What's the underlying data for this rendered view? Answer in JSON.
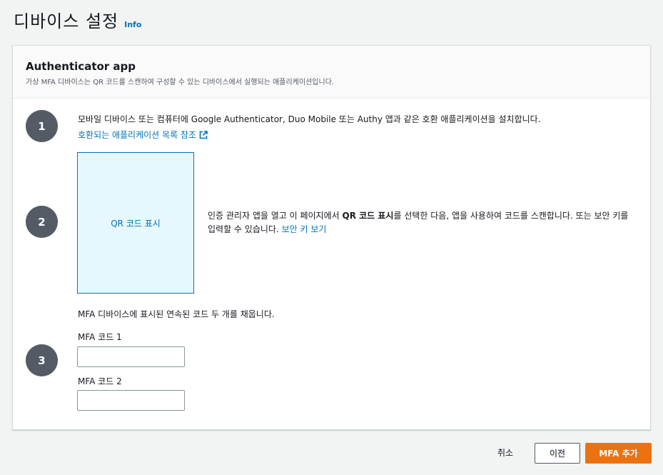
{
  "header": {
    "title": "디바이스 설정",
    "info_label": "Info"
  },
  "panel": {
    "title": "Authenticator app",
    "description": "가상 MFA 디바이스는 QR 코드를 스캔하여 구성할 수 있는 디바이스에서 실행되는 애플리케이션입니다."
  },
  "steps": {
    "step1": {
      "number": "1",
      "text": "모바일 디바이스 또는 컴퓨터에 Google Authenticator, Duo Mobile 또는 Authy 앱과 같은 호환 애플리케이션을 설치합니다.",
      "link": "호환되는 애플리케이션 목록 참조"
    },
    "step2": {
      "number": "2",
      "qr_label": "QR 코드 표시",
      "text_part1": "인증 관리자 앱을 열고 이 페이지에서 ",
      "text_bold": "QR 코드 표시",
      "text_part2": "를 선택한 다음, 앱을 사용하여 코드를 스캔합니다. 또는 보안 키를 입력할 수 있습니다. ",
      "link": "보안 키 보기"
    },
    "step3": {
      "number": "3",
      "text": "MFA 디바이스에 표시된 연속된 코드 두 개를 채웁니다.",
      "code1_label": "MFA 코드 1",
      "code1_value": "",
      "code2_label": "MFA 코드 2",
      "code2_value": ""
    }
  },
  "footer": {
    "cancel_label": "취소",
    "prev_label": "이전",
    "submit_label": "MFA 추가"
  },
  "colors": {
    "link": "#0073bb",
    "primary_button": "#ec7211",
    "step_circle": "#545b64",
    "qr_background": "#e7f8fd"
  },
  "icons": {
    "external_link": "external-link-icon"
  }
}
